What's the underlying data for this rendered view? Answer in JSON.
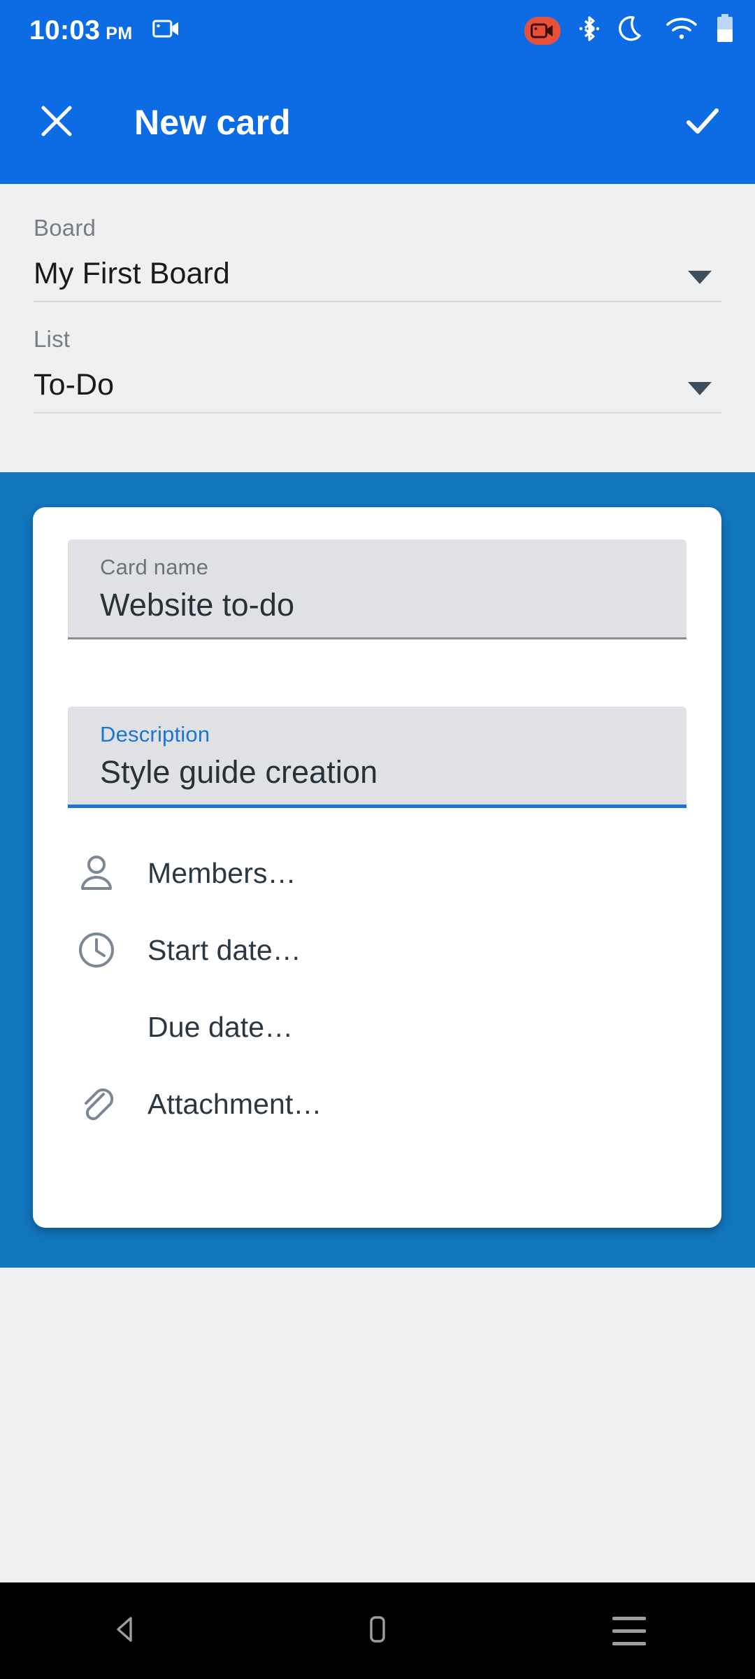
{
  "status_bar": {
    "time": "10:03",
    "am_pm": "PM",
    "left_icons": [
      "screen-record-icon"
    ],
    "right_icons": [
      "recording-badge-icon",
      "bluetooth-icon",
      "do-not-disturb-moon-icon",
      "wifi-icon",
      "battery-icon"
    ]
  },
  "app_bar": {
    "close_label": "close-icon",
    "title": "New card",
    "confirm_label": "check-icon"
  },
  "selectors": [
    {
      "label": "Board",
      "value": "My First Board"
    },
    {
      "label": "List",
      "value": "To-Do"
    }
  ],
  "card": {
    "name_field": {
      "label": "Card name",
      "value": "Website to-do",
      "focused": false
    },
    "description_field": {
      "label": "Description",
      "value": "Style guide creation",
      "focused": true
    },
    "attributes": [
      {
        "icon": "person-icon",
        "label": "Members…"
      },
      {
        "icon": "clock-icon",
        "label": "Start date…"
      },
      {
        "icon": "none",
        "label": "Due date…"
      },
      {
        "icon": "paperclip-icon",
        "label": "Attachment…"
      }
    ]
  },
  "nav_bar": {
    "back_label": "back-triangle-icon",
    "home_label": "home-rect-icon",
    "recents_label": "recents-lines-icon"
  },
  "colors": {
    "app_bar_blue": "#0d6ce4",
    "board_blue": "#1276bd",
    "surface_grey": "#eff0f2",
    "field_grey": "#dfe1e5",
    "accent_blue": "#1976d2",
    "record_red": "#e8503a",
    "text_dark": "#263238",
    "text_muted": "#6e7378"
  }
}
